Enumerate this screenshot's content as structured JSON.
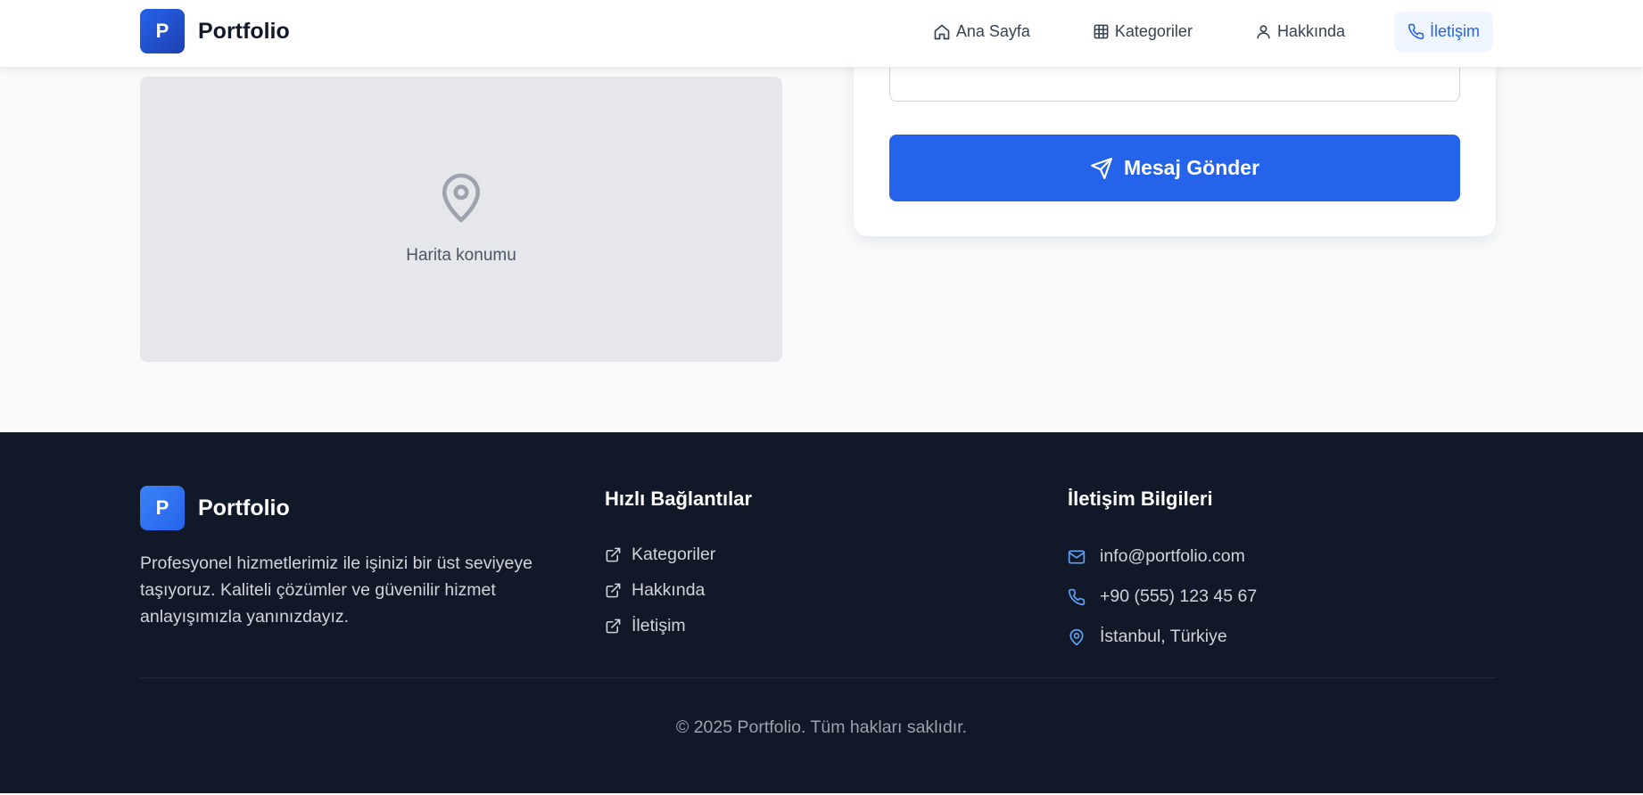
{
  "header": {
    "logo_letter": "P",
    "brand": "Portfolio",
    "nav": [
      {
        "label": "Ana Sayfa",
        "icon": "home-icon"
      },
      {
        "label": "Kategoriler",
        "icon": "grid-icon"
      },
      {
        "label": "Hakkında",
        "icon": "user-icon"
      },
      {
        "label": "İletişim",
        "icon": "phone-icon",
        "active": true
      }
    ]
  },
  "main": {
    "map_label": "Harita konumu",
    "send_button": "Mesaj Gönder"
  },
  "footer": {
    "logo_letter": "P",
    "brand": "Portfolio",
    "description": "Profesyonel hizmetlerimiz ile işinizi bir üst seviyeye taşıyoruz. Kaliteli çözümler ve güvenilir hizmet anlayışımızla yanınızdayız.",
    "quick_links_title": "Hızlı Bağlantılar",
    "quick_links": [
      "Kategoriler",
      "Hakkında",
      "İletişim"
    ],
    "contact_title": "İletişim Bilgileri",
    "contact": {
      "email": "info@portfolio.com",
      "phone": "+90 (555) 123 45 67",
      "address": "İstanbul, Türkiye"
    },
    "copyright": "© 2025 Portfolio. Tüm hakları saklıdır."
  },
  "colors": {
    "primary": "#2563eb",
    "footer_bg": "#111827",
    "page_bg": "#f8fafc"
  }
}
